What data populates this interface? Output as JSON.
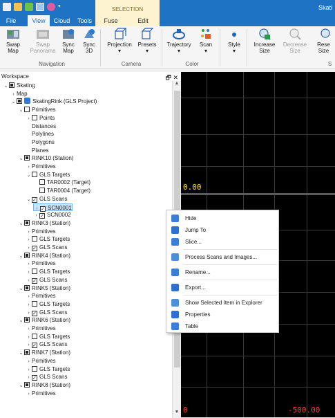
{
  "app": {
    "title": "Skati"
  },
  "quick_access": [
    "save-icon",
    "folder-icon",
    "share-icon",
    "document-icon",
    "settings-icon"
  ],
  "contextual_group": "SELECTION",
  "tabs": [
    "File",
    "View",
    "Cloud",
    "Tools",
    "Fuse",
    "Edit"
  ],
  "active_tab": "View",
  "ribbon": {
    "buttons": [
      {
        "label": "Swap\nMap",
        "icon": "map-icon",
        "enabled": true
      },
      {
        "label": "Swap\nPanorama",
        "icon": "panorama-icon",
        "enabled": false
      },
      {
        "label": "Sync\nMap",
        "icon": "sync-map-icon",
        "enabled": true
      },
      {
        "label": "Sync\n3D",
        "icon": "sync-3d-icon",
        "enabled": true
      },
      {
        "label": "Projection",
        "icon": "cube-icon",
        "enabled": true,
        "dropdown": true
      },
      {
        "label": "Presets",
        "icon": "cube-outline-icon",
        "enabled": true,
        "dropdown": true
      },
      {
        "label": "Trajectory",
        "icon": "trajectory-icon",
        "enabled": true,
        "dropdown": true
      },
      {
        "label": "Scan",
        "icon": "scan-icon",
        "enabled": true,
        "dropdown": true
      },
      {
        "label": "Style",
        "icon": "dot-icon",
        "enabled": true,
        "dropdown": true
      },
      {
        "label": "Increase\nSize",
        "icon": "zoom-in-icon",
        "enabled": true
      },
      {
        "label": "Decrease\nSize",
        "icon": "zoom-out-icon",
        "enabled": false
      },
      {
        "label": "Rese\nSize",
        "icon": "reset-size-icon",
        "enabled": true
      }
    ],
    "groups": [
      "Navigation",
      "Camera",
      "Color",
      "S"
    ]
  },
  "workspace": {
    "title": "Workspace",
    "pin_icon": "pin-icon",
    "close_icon": "close-icon",
    "tree": [
      {
        "label": "Skating",
        "level": 0,
        "arrow": "expanded",
        "check": "filled"
      },
      {
        "label": "Map",
        "level": 1,
        "arrow": "collapsed",
        "check": null
      },
      {
        "label": "SkatingRink (GLS Project)",
        "level": 1,
        "arrow": "expanded",
        "check": "filled",
        "icon": "project-icon"
      },
      {
        "label": "Primitives",
        "level": 2,
        "arrow": "expanded",
        "check": "empty"
      },
      {
        "label": "Points",
        "level": 3,
        "arrow": "collapsed",
        "check": "empty"
      },
      {
        "label": "Distances",
        "level": 3,
        "arrow": null,
        "check": null
      },
      {
        "label": "Polylines",
        "level": 3,
        "arrow": null,
        "check": null
      },
      {
        "label": "Polygons",
        "level": 3,
        "arrow": null,
        "check": null
      },
      {
        "label": "Planes",
        "level": 3,
        "arrow": null,
        "check": null
      },
      {
        "label": "RINK10 (Station)",
        "level": 2,
        "arrow": "expanded",
        "check": "filled"
      },
      {
        "label": "Primitives",
        "level": 3,
        "arrow": "collapsed",
        "check": null
      },
      {
        "label": "GLS Targets",
        "level": 3,
        "arrow": "expanded",
        "check": "empty"
      },
      {
        "label": "TAR0002 (Target)",
        "level": 4,
        "arrow": null,
        "check": "empty"
      },
      {
        "label": "TAR0004 (Target)",
        "level": 4,
        "arrow": null,
        "check": "empty"
      },
      {
        "label": "GLS Scans",
        "level": 3,
        "arrow": "expanded",
        "check": "checked"
      },
      {
        "label": "SCN0001",
        "level": 4,
        "arrow": "collapsed",
        "check": "checked",
        "selected": true
      },
      {
        "label": "SCN0002",
        "level": 4,
        "arrow": "collapsed",
        "check": "checked"
      },
      {
        "label": "RINK3 (Station)",
        "level": 2,
        "arrow": "expanded",
        "check": "filled"
      },
      {
        "label": "Primitives",
        "level": 3,
        "arrow": "collapsed",
        "check": null
      },
      {
        "label": "GLS Targets",
        "level": 3,
        "arrow": "collapsed",
        "check": "empty"
      },
      {
        "label": "GLS Scans",
        "level": 3,
        "arrow": "collapsed",
        "check": "checked"
      },
      {
        "label": "RINK4 (Station)",
        "level": 2,
        "arrow": "expanded",
        "check": "filled"
      },
      {
        "label": "Primitives",
        "level": 3,
        "arrow": "collapsed",
        "check": null
      },
      {
        "label": "GLS Targets",
        "level": 3,
        "arrow": "collapsed",
        "check": "empty"
      },
      {
        "label": "GLS Scans",
        "level": 3,
        "arrow": "collapsed",
        "check": "checked"
      },
      {
        "label": "RINK5 (Station)",
        "level": 2,
        "arrow": "expanded",
        "check": "filled"
      },
      {
        "label": "Primitives",
        "level": 3,
        "arrow": "collapsed",
        "check": null
      },
      {
        "label": "GLS Targets",
        "level": 3,
        "arrow": "collapsed",
        "check": "empty"
      },
      {
        "label": "GLS Scans",
        "level": 3,
        "arrow": "collapsed",
        "check": "checked"
      },
      {
        "label": "RINK6 (Station)",
        "level": 2,
        "arrow": "expanded",
        "check": "filled"
      },
      {
        "label": "Primitives",
        "level": 3,
        "arrow": "collapsed",
        "check": null
      },
      {
        "label": "GLS Targets",
        "level": 3,
        "arrow": "collapsed",
        "check": "empty"
      },
      {
        "label": "GLS Scans",
        "level": 3,
        "arrow": "collapsed",
        "check": "checked"
      },
      {
        "label": "RINK7 (Station)",
        "level": 2,
        "arrow": "expanded",
        "check": "filled"
      },
      {
        "label": "Primitives",
        "level": 3,
        "arrow": "collapsed",
        "check": null
      },
      {
        "label": "GLS Targets",
        "level": 3,
        "arrow": "collapsed",
        "check": "empty"
      },
      {
        "label": "GLS Scans",
        "level": 3,
        "arrow": "collapsed",
        "check": "checked"
      },
      {
        "label": "RINK8 (Station)",
        "level": 2,
        "arrow": "expanded",
        "check": "filled"
      },
      {
        "label": "Primitives",
        "level": 3,
        "arrow": "collapsed",
        "check": null
      }
    ]
  },
  "viewport": {
    "labels": {
      "top_left": "0.00",
      "bottom_left": "0",
      "bottom_right": "-500.00"
    },
    "colors": {
      "yellow": "#ffe600",
      "red": "#ff3b3b"
    }
  },
  "context_menu": [
    {
      "label": "Hide",
      "icon": "hide-icon",
      "color": "#3b7dd8"
    },
    {
      "label": "Jump To",
      "icon": "jump-to-icon",
      "color": "#2f6fd0"
    },
    {
      "label": "Slice...",
      "icon": "slice-icon",
      "color": "#3b7dd8"
    },
    {
      "separator": true
    },
    {
      "label": "Process Scans and Images...",
      "icon": "process-icon",
      "color": "#4a8fd8"
    },
    {
      "separator": true
    },
    {
      "label": "Rename...",
      "icon": "rename-icon",
      "color": "#3b7dd8"
    },
    {
      "separator": true
    },
    {
      "label": "Export...",
      "icon": "export-icon",
      "color": "#2f6fd0"
    },
    {
      "separator": true
    },
    {
      "label": "Show Selected Item in Explorer",
      "icon": "explorer-icon",
      "color": "#4a8fd8"
    },
    {
      "label": "Properties",
      "icon": "properties-icon",
      "color": "#2f6fd0"
    },
    {
      "label": "Table",
      "icon": "table-icon",
      "color": "#3b7dd8"
    }
  ]
}
